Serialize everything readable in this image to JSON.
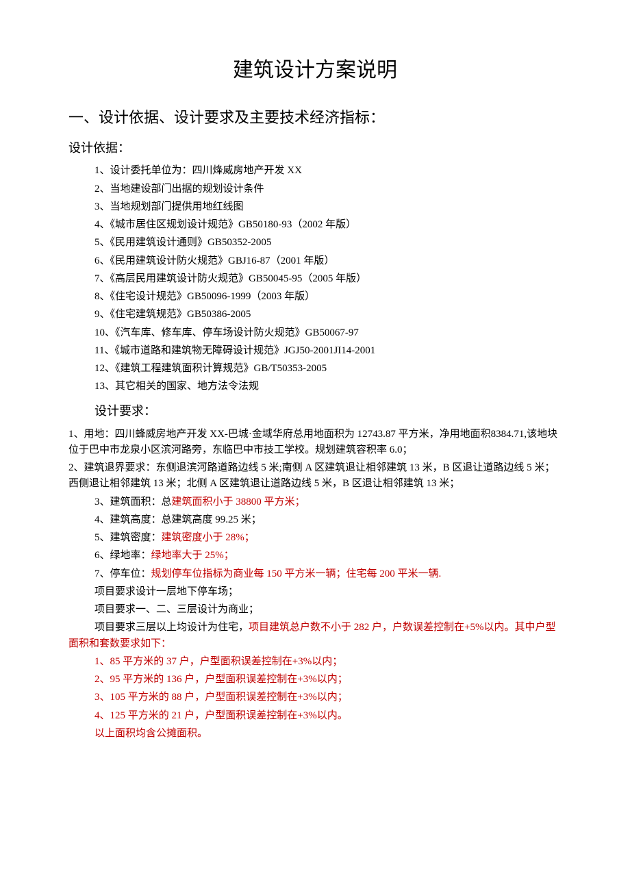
{
  "title": "建筑设计方案说明",
  "section1": {
    "heading": "一、设计依据、设计要求及主要技术经济指标：",
    "basis_heading": "设计依据：",
    "basis": [
      "1、设计委托单位为：四川烽威房地产开发 XX",
      "2、当地建设部门出据的规划设计条件",
      "3、当地规划部门提供用地红线图",
      "4、《城市居住区规划设计规范》GB50180-93（2002 年版）",
      "5、《民用建筑设计通则》GB50352-2005",
      "6、《民用建筑设计防火规范》GBJ16-87（2001 年版）",
      "7、《高层民用建筑设计防火规范》GB50045-95（2005 年版）",
      "8、《住宅设计规范》GB50096-1999（2003 年版）",
      "9、《住宅建筑规范》GB50386-2005",
      "10、《汽车库、修车库、停车场设计防火规范》GB50067-97",
      "11、《城市道路和建筑物无障碍设计规范》JGJ50-2001JI14-2001",
      "12、《建筑工程建筑面积计算规范》GB/T50353-2005",
      "13、其它相关的国家、地方法令法规"
    ],
    "req_heading": "设计要求：",
    "req": {
      "p1": "1、用地：四川蜂威房地产开发 XX-巴城·金域华府总用地面积为 12743.87 平方米，净用地面积8384.71,该地块位于巴中市龙泉小区滨河路旁，东临巴中市技工学校。规划建筑容积率 6.0；",
      "p2": "2、建筑退界要求：东侧退滨河路道路边线 5 米;南侧 A 区建筑退让相邻建筑 13 米，B 区退让道路边线 5 米；西侧退让相邻建筑 13 米；北侧 A 区建筑退让道路边线 5 米，B 区退让相邻建筑 13 米；",
      "p3a": "3、建筑面积：总",
      "p3b": "建筑面积小于 38800 平方米；",
      "p4": "4、建筑高度：总建筑高度 99.25 米；",
      "p5a": "5、建筑密度：",
      "p5b": "建筑密度小于 28%；",
      "p6a": "6、绿地率：",
      "p6b": "绿地率大于 25%；",
      "p7a": "7、停车位：",
      "p7b": "规划停车位指标为商业每 150 平方米一辆；住宅每 200 平米一辆.",
      "p8": "项目要求设计一层地下停车场；",
      "p9": "项目要求一、二、三层设计为商业；",
      "p10a": "项目要求三层以上均设计为住宅，",
      "p10b": "项目建筑总户数不小于 282 户，户数误差控制在+5%以内。其中户型面积和套数要求如下：",
      "types": [
        "1、85 平方米的 37 户，户型面积误差控制在+3%以内；",
        "2、95 平方米的 136 户，户型面积误差控制在+3%以内；",
        "3、105 平方米的 88 户，户型面积误差控制在+3%以内；",
        "4、125 平方米的 21 户，户型面积误差控制在+3%以内。"
      ],
      "note": "以上面积均含公摊面积。"
    }
  }
}
